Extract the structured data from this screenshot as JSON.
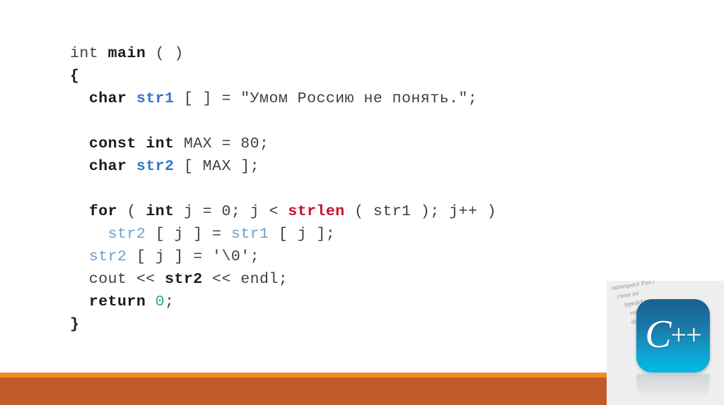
{
  "slide": {
    "background_color": "#ffffff",
    "accent_bar_light_color": "#ef8c23",
    "accent_bar_dark_color": "#c15a2b"
  },
  "code": {
    "language": "C++",
    "colors": {
      "plain": "#3f3f3f",
      "keyword": "#1a1a1a",
      "identifier_blue": "#3377cc",
      "identifier_light_blue": "#6d9fc9",
      "function_red": "#c8102e",
      "number_teal": "#2eab8f"
    },
    "lines": [
      {
        "id": "line-1",
        "tokens": [
          {
            "text": "int ",
            "style": "plain"
          },
          {
            "text": "main",
            "style": "kw"
          },
          {
            "text": " ( )",
            "style": "plain"
          }
        ]
      },
      {
        "id": "line-2",
        "tokens": [
          {
            "text": "{",
            "style": "brace"
          }
        ]
      },
      {
        "id": "line-3",
        "tokens": [
          {
            "text": "  ",
            "style": "plain"
          },
          {
            "text": "char",
            "style": "kw"
          },
          {
            "text": " ",
            "style": "plain"
          },
          {
            "text": "str1",
            "style": "id-blue"
          },
          {
            "text": " [ ] = \"Умом Россию не понять.\";",
            "style": "plain"
          }
        ]
      },
      {
        "id": "line-4",
        "blank": true,
        "tokens": []
      },
      {
        "id": "line-5",
        "tokens": [
          {
            "text": "  ",
            "style": "plain"
          },
          {
            "text": "const int",
            "style": "kw"
          },
          {
            "text": " MAX = 80;",
            "style": "plain"
          }
        ]
      },
      {
        "id": "line-6",
        "tokens": [
          {
            "text": "  ",
            "style": "plain"
          },
          {
            "text": "char",
            "style": "kw"
          },
          {
            "text": " ",
            "style": "plain"
          },
          {
            "text": "str2",
            "style": "id-blue"
          },
          {
            "text": " [ MAX ];",
            "style": "plain"
          }
        ]
      },
      {
        "id": "line-7",
        "blank": true,
        "tokens": []
      },
      {
        "id": "line-8",
        "tokens": [
          {
            "text": "  ",
            "style": "plain"
          },
          {
            "text": "for",
            "style": "kw"
          },
          {
            "text": " ( ",
            "style": "plain"
          },
          {
            "text": "int",
            "style": "kw"
          },
          {
            "text": " j = 0; j < ",
            "style": "plain"
          },
          {
            "text": "strlen",
            "style": "fn-red"
          },
          {
            "text": " ( str1 ); j++ )",
            "style": "plain"
          }
        ]
      },
      {
        "id": "line-9",
        "tokens": [
          {
            "text": "    ",
            "style": "plain"
          },
          {
            "text": "str2",
            "style": "id-lblue"
          },
          {
            "text": " [ j ] = ",
            "style": "plain"
          },
          {
            "text": "str1",
            "style": "id-lblue"
          },
          {
            "text": " [ j ];",
            "style": "plain"
          }
        ]
      },
      {
        "id": "line-10",
        "tokens": [
          {
            "text": "  ",
            "style": "plain"
          },
          {
            "text": "str2",
            "style": "id-lblue"
          },
          {
            "text": " [ j ] = '\\0';",
            "style": "plain"
          }
        ]
      },
      {
        "id": "line-11",
        "tokens": [
          {
            "text": "  cout << ",
            "style": "plain"
          },
          {
            "text": "str2",
            "style": "bold-bk"
          },
          {
            "text": " << endl;",
            "style": "plain"
          }
        ]
      },
      {
        "id": "line-12",
        "tokens": [
          {
            "text": "  ",
            "style": "plain"
          },
          {
            "text": "return",
            "style": "kw"
          },
          {
            "text": " ",
            "style": "plain"
          },
          {
            "text": "0",
            "style": "num-teal"
          },
          {
            "text": ";",
            "style": "plain"
          }
        ]
      },
      {
        "id": "line-13",
        "tokens": [
          {
            "text": "}",
            "style": "brace"
          }
        ]
      }
    ]
  },
  "logo": {
    "name": "cpp-logo",
    "glyph_letter": "C",
    "glyph_plus": "++",
    "tile_gradient_top": "#19608f",
    "tile_gradient_bottom": "#00b9e4",
    "background_code_lines": [
      "namespace Foo {",
      "const int",
      "typedef",
      "void f(",
      "double ",
      "}"
    ]
  }
}
